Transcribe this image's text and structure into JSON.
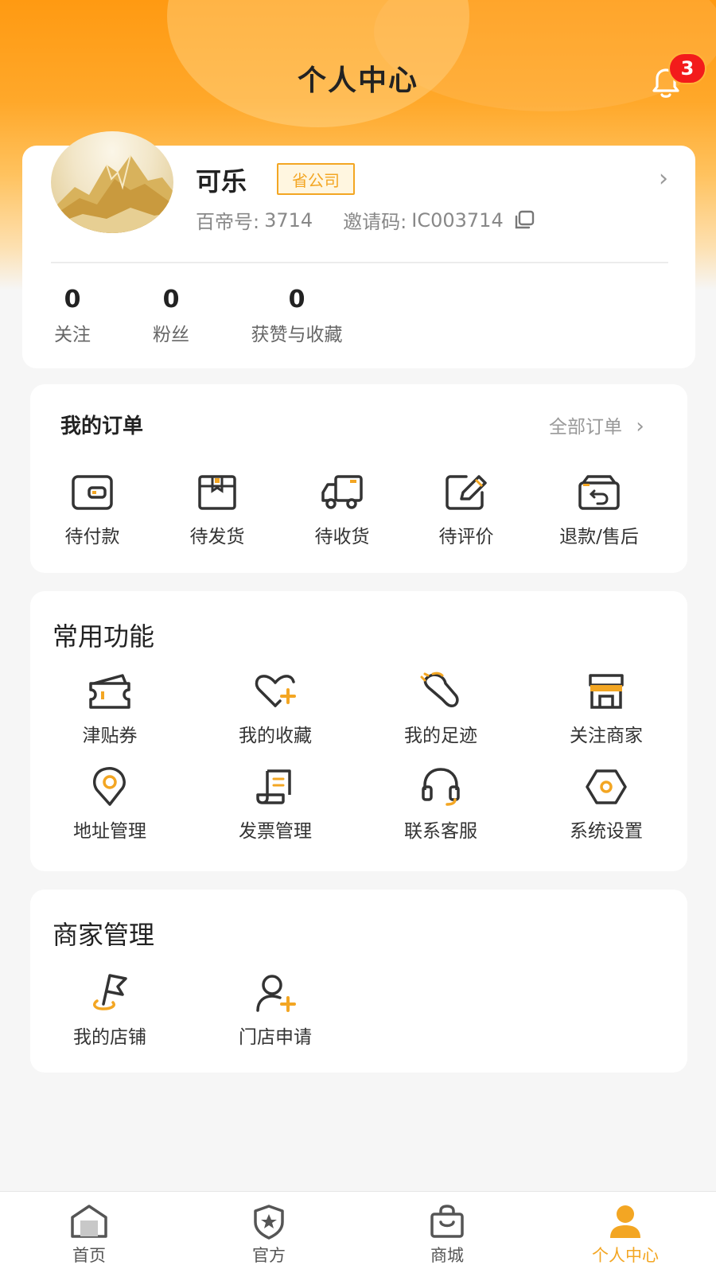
{
  "header": {
    "title": "个人中心",
    "notification_count": "3"
  },
  "profile": {
    "name": "可乐",
    "role_badge": "省公司",
    "id_label": "百帝号:",
    "id_value": "3714",
    "invite_label": "邀请码:",
    "invite_code": "IC003714",
    "stats": [
      {
        "value": "0",
        "label": "关注"
      },
      {
        "value": "0",
        "label": "粉丝"
      },
      {
        "value": "0",
        "label": "获赞与收藏"
      }
    ]
  },
  "orders": {
    "title": "我的订单",
    "all_link": "全部订单",
    "items": [
      {
        "label": "待付款",
        "icon": "wallet-icon"
      },
      {
        "label": "待发货",
        "icon": "package-icon"
      },
      {
        "label": "待收货",
        "icon": "truck-icon"
      },
      {
        "label": "待评价",
        "icon": "edit-review-icon"
      },
      {
        "label": "退款/售后",
        "icon": "refund-icon"
      }
    ]
  },
  "common": {
    "title": "常用功能",
    "items": [
      {
        "label": "津贴券",
        "icon": "coupon-icon"
      },
      {
        "label": "我的收藏",
        "icon": "heart-plus-icon"
      },
      {
        "label": "我的足迹",
        "icon": "footprint-icon"
      },
      {
        "label": "关注商家",
        "icon": "store-icon"
      },
      {
        "label": "地址管理",
        "icon": "location-icon"
      },
      {
        "label": "发票管理",
        "icon": "invoice-icon"
      },
      {
        "label": "联系客服",
        "icon": "headset-icon"
      },
      {
        "label": "系统设置",
        "icon": "settings-hex-icon"
      }
    ]
  },
  "merchant": {
    "title": "商家管理",
    "items": [
      {
        "label": "我的店铺",
        "icon": "flag-icon"
      },
      {
        "label": "门店申请",
        "icon": "user-plus-icon"
      }
    ]
  },
  "tabbar": {
    "items": [
      {
        "label": "首页",
        "icon": "home-icon"
      },
      {
        "label": "官方",
        "icon": "shield-star-icon"
      },
      {
        "label": "商城",
        "icon": "shopping-bag-icon"
      },
      {
        "label": "个人中心",
        "icon": "person-icon"
      }
    ],
    "active_index": 3
  },
  "colors": {
    "accent": "#f3a623",
    "header_gradient_top": "#ff9a12",
    "badge_red": "#f31b1b",
    "background": "#f6f6f6"
  }
}
